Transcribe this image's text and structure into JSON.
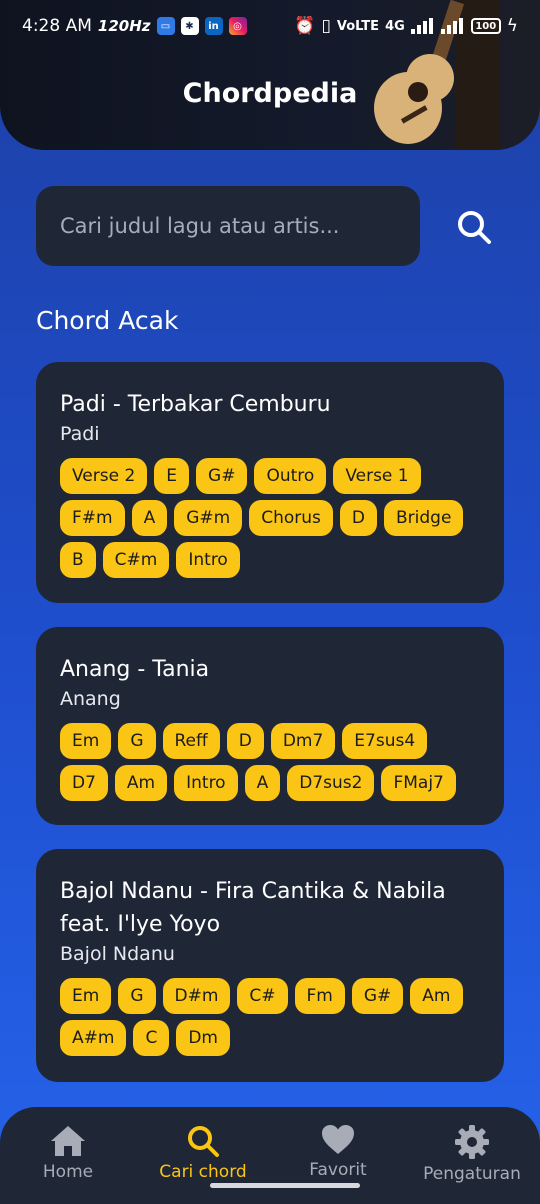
{
  "status_bar": {
    "time": "4:28 AM",
    "refresh": "120Hz",
    "network": "VoLTE",
    "network_type": "4G",
    "battery": "100"
  },
  "app": {
    "title": "Chordpedia"
  },
  "search": {
    "placeholder": "Cari judul lagu atau artis..."
  },
  "section": {
    "title": "Chord Acak"
  },
  "songs": [
    {
      "title": "Padi - Terbakar Cemburu",
      "artist": "Padi",
      "chords": [
        "Verse 2",
        "E",
        "G#",
        "Outro",
        "Verse 1",
        "F#m",
        "A",
        "G#m",
        "Chorus",
        "D",
        "Bridge",
        "B",
        "C#m",
        "Intro"
      ]
    },
    {
      "title": "Anang - Tania",
      "artist": "Anang",
      "chords": [
        "Em",
        "G",
        "Reff",
        "D",
        "Dm7",
        "E7sus4",
        "D7",
        "Am",
        "Intro",
        "A",
        "D7sus2",
        "FMaj7"
      ]
    },
    {
      "title": "Bajol Ndanu - Fira Cantika & Nabila feat. I'lye Yoyo",
      "artist": "Bajol Ndanu",
      "chords": [
        "Em",
        "G",
        "D#m",
        "C#",
        "Fm",
        "G#",
        "Am",
        "A#m",
        "C",
        "Dm"
      ]
    }
  ],
  "nav": [
    {
      "label": "Home",
      "icon": "home-icon",
      "active": false
    },
    {
      "label": "Cari chord",
      "icon": "search-icon",
      "active": true
    },
    {
      "label": "Favorit",
      "icon": "heart-icon",
      "active": false
    },
    {
      "label": "Pengaturan",
      "icon": "gear-icon",
      "active": false
    }
  ],
  "colors": {
    "accent": "#fac515",
    "card": "#1f2737",
    "background_top": "#1d40a6",
    "background_bottom": "#2563ea"
  }
}
